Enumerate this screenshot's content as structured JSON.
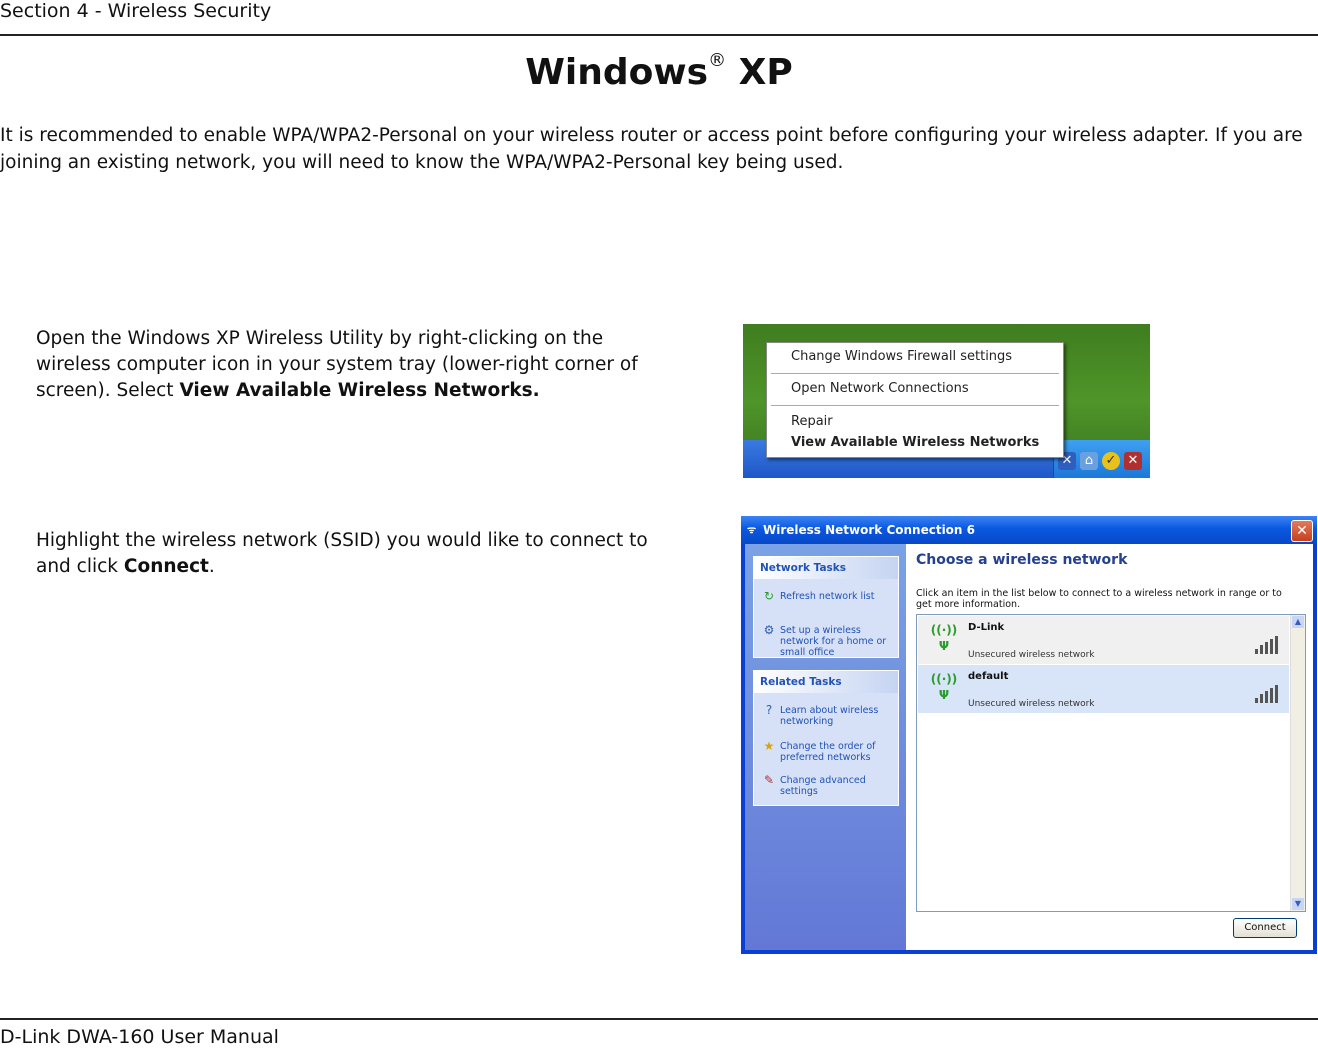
{
  "header": {
    "section": "Section 4 - Wireless Security"
  },
  "title": {
    "main": "Windows",
    "reg": "®",
    "suffix": " XP"
  },
  "intro": "It is recommended to enable WPA/WPA2-Personal on your wireless router or access point before configuring your wireless adapter. If you are joining an existing network, you will need to know the WPA/WPA2-Personal key being used.",
  "step1": {
    "text": "Open the Windows XP Wireless Utility by right-clicking on the wireless computer icon in your system tray (lower-right corner of screen). Select ",
    "bold": "View Available Wireless Networks."
  },
  "step2": {
    "text": "Highlight the wireless network (SSID) you would like to connect to and click ",
    "bold": "Connect",
    "end": "."
  },
  "tray_menu": {
    "items": [
      "Change Windows Firewall settings",
      "Open Network Connections",
      "Repair",
      "View Available Wireless Networks"
    ]
  },
  "dialog": {
    "title": "Wireless Network Connection 6",
    "network_tasks": {
      "header": "Network Tasks",
      "refresh": "Refresh network list",
      "setup": "Set up a wireless network for a home or small office"
    },
    "related_tasks": {
      "header": "Related Tasks",
      "learn": "Learn about wireless networking",
      "order": "Change the order of preferred networks",
      "advanced": "Change advanced settings"
    },
    "heading": "Choose a wireless network",
    "instruction": "Click an item in the list below to connect to a wireless network in range or to get more information.",
    "networks": [
      {
        "name": "D-Link",
        "status": "Unsecured wireless network"
      },
      {
        "name": "default",
        "status": "Unsecured wireless network"
      }
    ],
    "connect_label": "Connect"
  },
  "footer": {
    "text": "D-Link DWA-160 User Manual"
  }
}
